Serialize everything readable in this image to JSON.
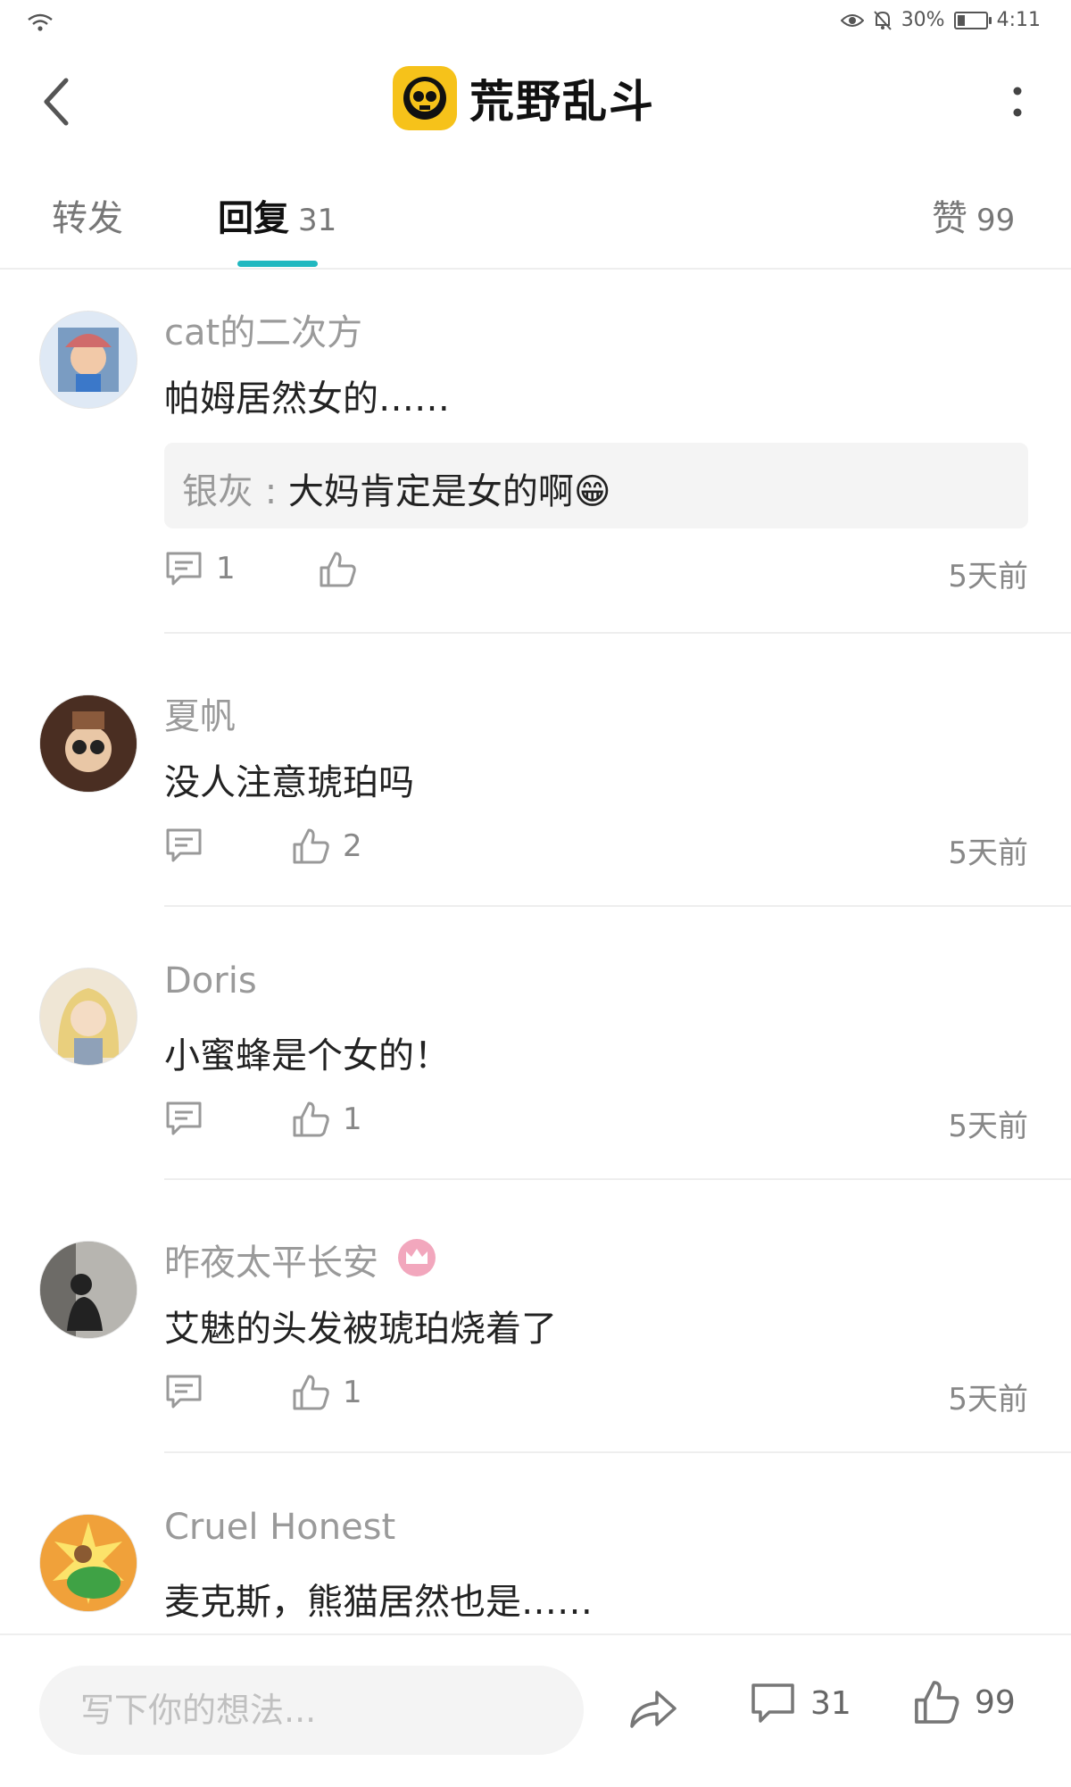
{
  "status": {
    "battery": "30%",
    "battery_level": 0.3,
    "time": "4:11"
  },
  "header": {
    "title": "荒野乱斗",
    "logo": "brawl-stars-skull-icon"
  },
  "tabs": {
    "forward": "转发",
    "reply": "回复",
    "reply_count": "31",
    "like": "赞",
    "like_count": "99"
  },
  "comments": [
    {
      "user": "cat的二次方",
      "text": "帕姆居然女的……",
      "quote_author": "银灰 :",
      "quote_text": "大妈肯定是女的啊😁",
      "reply_count": "1",
      "like_count": "",
      "time": "5天前"
    },
    {
      "user": "夏帆",
      "text": "没人注意琥珀吗",
      "reply_count": "",
      "like_count": "2",
      "time": "5天前"
    },
    {
      "user": "Doris",
      "text": "小蜜蜂是个女的！",
      "reply_count": "",
      "like_count": "1",
      "time": "5天前"
    },
    {
      "user": "昨夜太平长安",
      "text": "艾魅的头发被琥珀烧着了",
      "reply_count": "",
      "like_count": "1",
      "time": "5天前",
      "badge": "crown-badge-icon"
    },
    {
      "user": "Cruel Honest",
      "text": "麦克斯，熊猫居然也是……"
    }
  ],
  "bottom": {
    "placeholder": "写下你的想法...",
    "comment_count": "31",
    "like_count": "99"
  }
}
